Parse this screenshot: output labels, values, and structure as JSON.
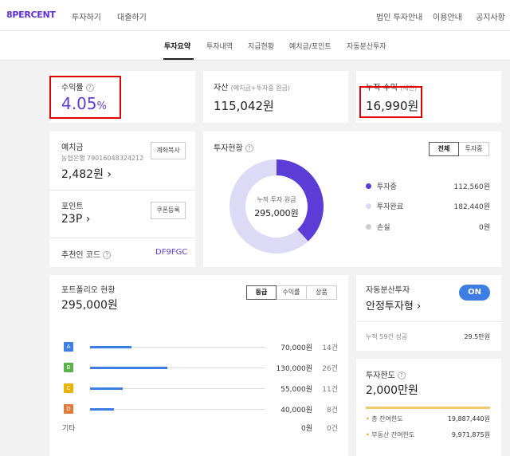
{
  "header": {
    "logo": "8PERCENT",
    "nav_left": [
      "투자하기",
      "대출하기"
    ],
    "nav_right": [
      "법인 투자안내",
      "이용안내",
      "공지사항"
    ]
  },
  "subnav": {
    "tabs": [
      "투자요약",
      "투자내역",
      "지급현황",
      "예치금/포인트",
      "자동분산투자"
    ],
    "active": 0
  },
  "summary": {
    "yield_label": "수익률",
    "yield_value": "4.05",
    "yield_unit": "%",
    "asset_label": "자산",
    "asset_sub": "(예치금+투자중 원금)",
    "asset_value": "115,042원",
    "income_label": "누적 수익",
    "income_sub": "(세전)",
    "income_value": "16,990원"
  },
  "deposit": {
    "label": "예치금",
    "account": "농협은행 79016048324212",
    "copy_button": "계좌복사",
    "value": "2,482원",
    "point_label": "포인트",
    "point_value": "23P",
    "coupon_button": "쿠폰등록",
    "referral_label": "추천인 코드",
    "referral_code": "DF9FGC"
  },
  "investment": {
    "title": "투자현황",
    "tabs": [
      "전체",
      "투자중"
    ],
    "center_label": "누적 투자 원금",
    "center_value": "295,000원",
    "legend": [
      {
        "name": "투자중",
        "value": "112,560원",
        "color": "#5b3cd6"
      },
      {
        "name": "투자완료",
        "value": "182,440원",
        "color": "#dcdaf5"
      },
      {
        "name": "손실",
        "value": "0원",
        "color": "#cfcfcf"
      }
    ]
  },
  "portfolio": {
    "title": "포트폴리오 현황",
    "total": "295,000원",
    "tabs": [
      "등급",
      "수익률",
      "상품"
    ],
    "rows": [
      {
        "grade": "A",
        "color": "#3d7ee3",
        "amount": "70,000원",
        "count": "14건",
        "ratio": 0.237
      },
      {
        "grade": "B",
        "color": "#5bb34a",
        "amount": "130,000원",
        "count": "26건",
        "ratio": 0.44
      },
      {
        "grade": "C",
        "color": "#e8b400",
        "amount": "55,000원",
        "count": "11건",
        "ratio": 0.186
      },
      {
        "grade": "D",
        "color": "#e07b39",
        "amount": "40,000원",
        "count": "8건",
        "ratio": 0.136
      }
    ],
    "other": {
      "label": "기타",
      "amount": "0원",
      "count": "0건"
    }
  },
  "auto": {
    "label": "자동분산투자",
    "toggle": "ON",
    "type": "안정투자형",
    "count_label": "누적 59건 성공",
    "count_value": "29.5만원"
  },
  "limit": {
    "label": "투자한도",
    "value": "2,000만원",
    "rows": [
      {
        "name": "총 잔여한도",
        "value": "19,887,440원"
      },
      {
        "name": "부동산 잔여한도",
        "value": "9,971,875원"
      }
    ]
  }
}
